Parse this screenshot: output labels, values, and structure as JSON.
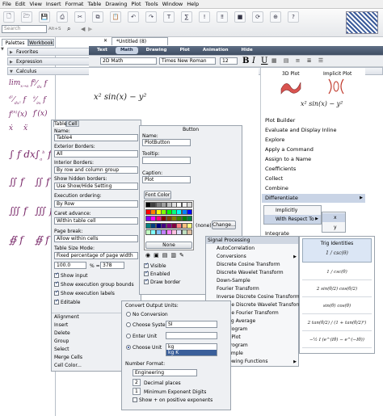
{
  "menubar": [
    "File",
    "Edit",
    "View",
    "Insert",
    "Format",
    "Table",
    "Drawing",
    "Plot",
    "Tools",
    "Window",
    "Help"
  ],
  "search": {
    "placeholder": "Search",
    "shortcut": "Alt+S"
  },
  "document_tab": "*Untitled (8)",
  "left_tabs": [
    "Palettes",
    "Workbook"
  ],
  "palettes": [
    {
      "label": "Favorites",
      "open": false
    },
    {
      "label": "Expression",
      "open": false
    },
    {
      "label": "Calculus",
      "open": true
    }
  ],
  "mode_tabs": [
    "Text",
    "Math",
    "Drawing",
    "Plot",
    "Animation",
    "Hide"
  ],
  "active_mode": "Math",
  "format_bar": {
    "style": "2D Math",
    "font": "Times New Roman",
    "size": "12",
    "bold": "B",
    "italic": "I",
    "underline": "U"
  },
  "doc_expression": "x² sin(x) − y²",
  "context_panel": {
    "plot_labels": [
      "3D Plot",
      "Implicit Plot"
    ],
    "expression": "x² sin(x) − y²",
    "items": [
      "Plot Builder",
      "Evaluate and Display Inline",
      "Explore",
      "Apply a Command",
      "Assign to a Name",
      "Coefficients",
      "Collect",
      "Combine",
      "Differentiate",
      "Integrate"
    ],
    "active_item": "Differentiate"
  },
  "differentiate_submenu": [
    "Implicitly",
    "With Respect To"
  ],
  "variable_submenu": [
    "x",
    "y"
  ],
  "table_properties": {
    "tabs": [
      "Table",
      "Cell"
    ],
    "name_label": "Name:",
    "name_value": "Table4",
    "exterior_borders_label": "Exterior Borders:",
    "exterior_borders_value": "All",
    "interior_borders_label": "Interior Borders:",
    "interior_borders_value": "By row and column group",
    "show_hidden_label": "Show hidden borders:",
    "show_hidden_value": "Use Show/Hide Setting",
    "exec_order_label": "Execution ordering:",
    "exec_order_value": "By Row",
    "caret_label": "Caret advance:",
    "caret_value": "Within table cell",
    "page_break_label": "Page break:",
    "page_break_value": "Allow within cells",
    "size_mode_label": "Table Size Mode:",
    "size_mode_value": "Fixed percentage of page width",
    "width_value": "100.0",
    "width_unit": "% =",
    "width_px": "378",
    "checks": [
      {
        "label": "Show input",
        "on": true
      },
      {
        "label": "Show execution group bounds",
        "on": true
      },
      {
        "label": "Show execution labels",
        "on": true
      },
      {
        "label": "Editable",
        "on": true
      }
    ],
    "menu": [
      "Alignment",
      "Insert",
      "Delete",
      "Group",
      "Select",
      "Merge Cells",
      "Cell Color..."
    ]
  },
  "button_properties": {
    "title": "Button",
    "name_label": "Name:",
    "name_value": "PlotButton",
    "tooltip_label": "Tooltip:",
    "caption_label": "Caption:",
    "caption_value": "Plot",
    "font_color_button": "Font Color",
    "none_label": "(none)",
    "change_button": "Change...",
    "none_swatch_label": "None",
    "checks": [
      {
        "label": "Visible",
        "on": true
      },
      {
        "label": "Enabled",
        "on": true
      },
      {
        "label": "Draw border",
        "on": true
      }
    ],
    "swatch_colors": [
      [
        "#000000",
        "#404040",
        "#808080",
        "#a0a0a0",
        "#c0c0c0",
        "#e0e0e0",
        "#ffffff",
        "#f2f2f2",
        "#d9d9d9"
      ],
      [
        "#ff0000",
        "#ff8000",
        "#ffff00",
        "#80ff00",
        "#00ff00",
        "#00ff80",
        "#00ffff",
        "#0080ff",
        "#0000ff"
      ],
      [
        "#8000ff",
        "#ff00ff",
        "#ff0080",
        "#800000",
        "#804000",
        "#808000",
        "#408000",
        "#008000",
        "#008040"
      ],
      [
        "#008080",
        "#004080",
        "#000080",
        "#400080",
        "#800080",
        "#800040",
        "#ff8080",
        "#ffc080",
        "#ffff80"
      ],
      [
        "#c0ffc0",
        "#80ffff",
        "#80c0ff",
        "#c080ff",
        "#ff80ff",
        "#ffc0e0",
        "#e0e0ff",
        "#c0e0c0",
        "#e0c0a0"
      ]
    ]
  },
  "signal_processing": {
    "title": "Signal Processing",
    "items": [
      "AutoCorrelation",
      "Conversions",
      "Discrete Cosine Transform",
      "Discrete Wavelet Transform",
      "Down-Sample",
      "Fourier Transform",
      "Inverse Discrete Cosine Transform",
      "Inverse Discrete Wavelet Transform",
      "Inverse Fourier Transform",
      "Moving Average",
      "Periodogram",
      "SignalPlot",
      "Spectrogram",
      "Up-Sample",
      "Windowing Functions"
    ],
    "submenu_items": [
      "Conversions",
      "Windowing Functions"
    ]
  },
  "trig_identities": {
    "title": "Trig Identities",
    "items": [
      "1 / csc(θ)",
      "2 sin(θ/2) cos(θ/2)",
      "sin(θ) cos(θ)",
      "2 tan(θ/2) / (1 + tan(θ/2)²)",
      "−½ I (e^(Iθ) − e^(−Iθ))"
    ],
    "header_expr": "1 / csc(θ)"
  },
  "unit_conversion": {
    "title": "Convert Output Units:",
    "options": [
      "No Conversion",
      "Choose System",
      "Enter Unit",
      "Choose Unit"
    ],
    "selected": "Choose Unit",
    "system_value": "SI",
    "unit_list": [
      "kg",
      "kg K"
    ],
    "number_format_label": "Number Format:",
    "number_format_value": "Engineering",
    "decimal_value": "2",
    "decimal_label": "Decimal places",
    "exp_digits_value": "1",
    "exp_digits_label": "Minimum Exponent Digits",
    "show_plus_label": "Show + on positive exponents"
  }
}
